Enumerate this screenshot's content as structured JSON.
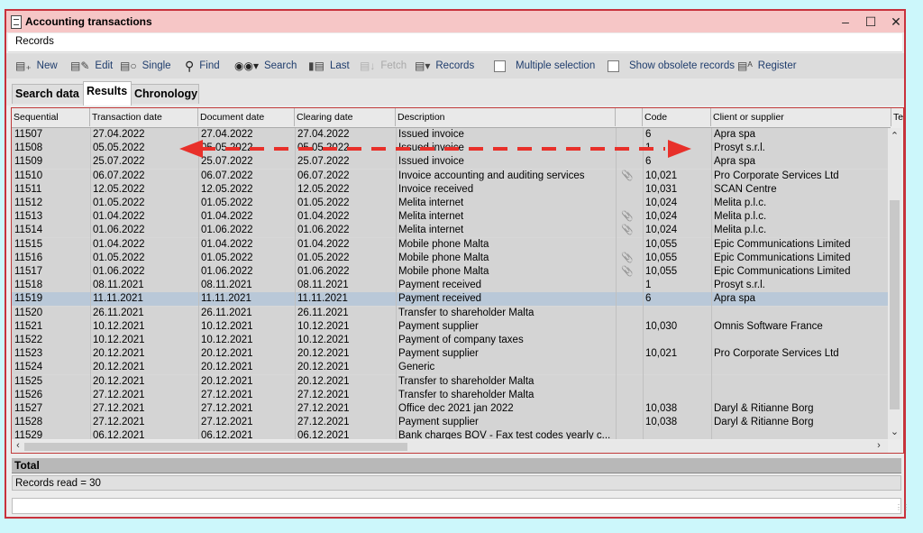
{
  "window": {
    "title": "Accounting transactions",
    "controls": {
      "minimize": "–",
      "maximize": "☐",
      "close": "✕"
    }
  },
  "menu": {
    "records": "Records"
  },
  "toolbar": {
    "new": "New",
    "edit": "Edit",
    "single": "Single",
    "find": "Find",
    "search": "Search",
    "last": "Last",
    "fetch": "Fetch",
    "records": "Records",
    "multiple_selection": "Multiple selection",
    "show_obsolete": "Show obsolete records",
    "register": "Register"
  },
  "tabs": [
    "Search data",
    "Results",
    "Chronology"
  ],
  "columns": [
    "Sequential",
    "Transaction date",
    "Document date",
    "Clearing date",
    "Description",
    "",
    "Code",
    "Client or supplier",
    "Te"
  ],
  "rows": [
    {
      "seq": "11507",
      "tdate": "27.04.2022",
      "ddate": "27.04.2022",
      "cdate": "27.04.2022",
      "desc": "Issued invoice",
      "att": false,
      "code": "6",
      "client": "Apra spa"
    },
    {
      "seq": "11508",
      "tdate": "05.05.2022",
      "ddate": "05.05.2022",
      "cdate": "05.05.2022",
      "desc": "Issued invoice",
      "att": false,
      "code": "1",
      "client": "Prosyt s.r.l."
    },
    {
      "seq": "11509",
      "tdate": "25.07.2022",
      "ddate": "25.07.2022",
      "cdate": "25.07.2022",
      "desc": "Issued invoice",
      "att": false,
      "code": "6",
      "client": "Apra spa"
    },
    {
      "seq": "11510",
      "tdate": "06.07.2022",
      "ddate": "06.07.2022",
      "cdate": "06.07.2022",
      "desc": "Invoice accounting and auditing services",
      "att": true,
      "code": "10,021",
      "client": "Pro Corporate Services Ltd"
    },
    {
      "seq": "11511",
      "tdate": "12.05.2022",
      "ddate": "12.05.2022",
      "cdate": "12.05.2022",
      "desc": "Invoice received",
      "att": false,
      "code": "10,031",
      "client": "SCAN Centre"
    },
    {
      "seq": "11512",
      "tdate": "01.05.2022",
      "ddate": "01.05.2022",
      "cdate": "01.05.2022",
      "desc": "Melita internet",
      "att": false,
      "code": "10,024",
      "client": "Melita p.l.c."
    },
    {
      "seq": "11513",
      "tdate": "01.04.2022",
      "ddate": "01.04.2022",
      "cdate": "01.04.2022",
      "desc": "Melita internet",
      "att": true,
      "code": "10,024",
      "client": "Melita p.l.c."
    },
    {
      "seq": "11514",
      "tdate": "01.06.2022",
      "ddate": "01.06.2022",
      "cdate": "01.06.2022",
      "desc": "Melita internet",
      "att": true,
      "code": "10,024",
      "client": "Melita p.l.c."
    },
    {
      "seq": "11515",
      "tdate": "01.04.2022",
      "ddate": "01.04.2022",
      "cdate": "01.04.2022",
      "desc": "Mobile phone Malta",
      "att": false,
      "code": "10,055",
      "client": "Epic Communications Limited"
    },
    {
      "seq": "11516",
      "tdate": "01.05.2022",
      "ddate": "01.05.2022",
      "cdate": "01.05.2022",
      "desc": "Mobile phone Malta",
      "att": true,
      "code": "10,055",
      "client": "Epic Communications Limited"
    },
    {
      "seq": "11517",
      "tdate": "01.06.2022",
      "ddate": "01.06.2022",
      "cdate": "01.06.2022",
      "desc": "Mobile phone Malta",
      "att": true,
      "code": "10,055",
      "client": "Epic Communications Limited"
    },
    {
      "seq": "11518",
      "tdate": "08.11.2021",
      "ddate": "08.11.2021",
      "cdate": "08.11.2021",
      "desc": "Payment received",
      "att": false,
      "code": "1",
      "client": "Prosyt s.r.l."
    },
    {
      "seq": "11519",
      "tdate": "11.11.2021",
      "ddate": "11.11.2021",
      "cdate": "11.11.2021",
      "desc": "Payment received",
      "att": false,
      "code": "6",
      "client": "Apra spa",
      "selected": true
    },
    {
      "seq": "11520",
      "tdate": "26.11.2021",
      "ddate": "26.11.2021",
      "cdate": "26.11.2021",
      "desc": "Transfer to shareholder Malta",
      "att": false,
      "code": "",
      "client": ""
    },
    {
      "seq": "11521",
      "tdate": "10.12.2021",
      "ddate": "10.12.2021",
      "cdate": "10.12.2021",
      "desc": "Payment supplier",
      "att": false,
      "code": "10,030",
      "client": "Omnis Software France"
    },
    {
      "seq": "11522",
      "tdate": "10.12.2021",
      "ddate": "10.12.2021",
      "cdate": "10.12.2021",
      "desc": "Payment of company taxes",
      "att": false,
      "code": "",
      "client": ""
    },
    {
      "seq": "11523",
      "tdate": "20.12.2021",
      "ddate": "20.12.2021",
      "cdate": "20.12.2021",
      "desc": "Payment supplier",
      "att": false,
      "code": "10,021",
      "client": "Pro Corporate Services Ltd"
    },
    {
      "seq": "11524",
      "tdate": "20.12.2021",
      "ddate": "20.12.2021",
      "cdate": "20.12.2021",
      "desc": "Generic",
      "att": false,
      "code": "",
      "client": ""
    },
    {
      "seq": "11525",
      "tdate": "20.12.2021",
      "ddate": "20.12.2021",
      "cdate": "20.12.2021",
      "desc": "Transfer to shareholder Malta",
      "att": false,
      "code": "",
      "client": ""
    },
    {
      "seq": "11526",
      "tdate": "27.12.2021",
      "ddate": "27.12.2021",
      "cdate": "27.12.2021",
      "desc": "Transfer to shareholder Malta",
      "att": false,
      "code": "",
      "client": ""
    },
    {
      "seq": "11527",
      "tdate": "27.12.2021",
      "ddate": "27.12.2021",
      "cdate": "27.12.2021",
      "desc": "Office dec 2021 jan 2022",
      "att": false,
      "code": "10,038",
      "client": "Daryl & Ritianne Borg"
    },
    {
      "seq": "11528",
      "tdate": "27.12.2021",
      "ddate": "27.12.2021",
      "cdate": "27.12.2021",
      "desc": "Payment supplier",
      "att": false,
      "code": "10,038",
      "client": "Daryl & Ritianne Borg"
    },
    {
      "seq": "11529",
      "tdate": "06.12.2021",
      "ddate": "06.12.2021",
      "cdate": "06.12.2021",
      "desc": "Bank charges BOV - Fax test codes yearly c...",
      "att": false,
      "code": "",
      "client": ""
    }
  ],
  "footer": {
    "total": "Total",
    "records_read": "Records read = 30"
  },
  "annotation_color": "#e8302a",
  "icons": {
    "attachment": "paperclip-icon"
  }
}
